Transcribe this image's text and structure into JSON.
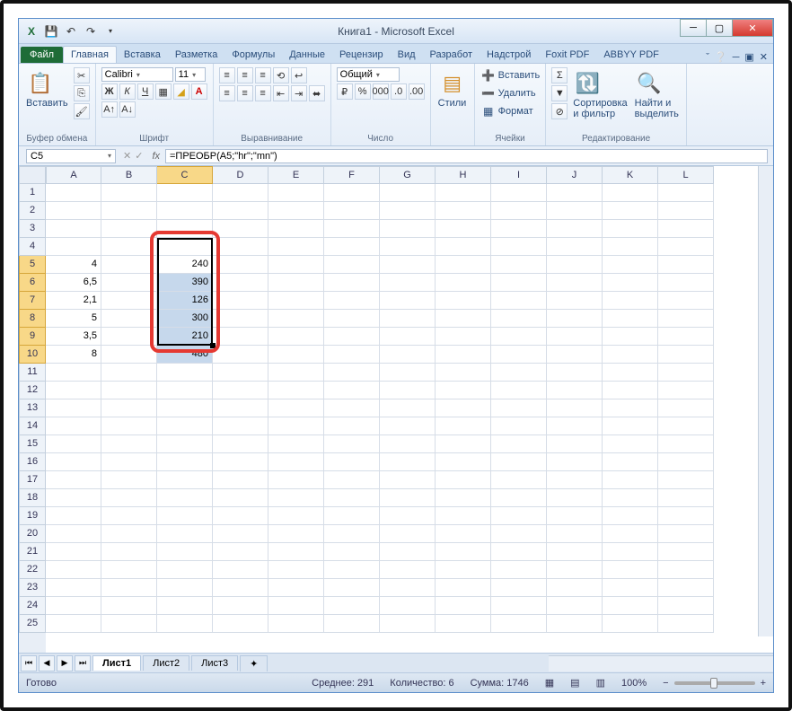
{
  "title": "Книга1  -  Microsoft Excel",
  "tabs": {
    "file": "Файл",
    "home": "Главная",
    "insert": "Вставка",
    "layout": "Разметка",
    "formulas": "Формулы",
    "data": "Данные",
    "review": "Рецензир",
    "view": "Вид",
    "dev": "Разработ",
    "addins": "Надстрой",
    "foxit": "Foxit PDF",
    "abbyy": "ABBYY PDF"
  },
  "groups": {
    "clipboard": {
      "label": "Буфер обмена",
      "paste": "Вставить"
    },
    "font": {
      "label": "Шрифт",
      "name": "Calibri",
      "size": "11"
    },
    "align": {
      "label": "Выравнивание"
    },
    "number": {
      "label": "Число",
      "format": "Общий"
    },
    "styles": {
      "label": "Стили",
      "btn": "Стили"
    },
    "cells": {
      "label": "Ячейки",
      "ins": "Вставить",
      "del": "Удалить",
      "fmt": "Формат"
    },
    "edit": {
      "label": "Редактирование",
      "sort": "Сортировка\nи фильтр",
      "find": "Найти и\nвыделить"
    }
  },
  "namebox": "C5",
  "formula": "=ПРЕОБР(A5;\"hr\";\"mn\")",
  "columns": [
    "A",
    "B",
    "C",
    "D",
    "E",
    "F",
    "G",
    "H",
    "I",
    "J",
    "K",
    "L"
  ],
  "rows": [
    "1",
    "2",
    "3",
    "4",
    "5",
    "6",
    "7",
    "8",
    "9",
    "10",
    "11",
    "12",
    "13",
    "14",
    "15",
    "16",
    "17",
    "18",
    "19",
    "20",
    "21",
    "22",
    "23",
    "24",
    "25"
  ],
  "dataA": {
    "5": "4",
    "6": "6,5",
    "7": "2,1",
    "8": "5",
    "9": "3,5",
    "10": "8"
  },
  "dataC": {
    "5": "240",
    "6": "390",
    "7": "126",
    "8": "300",
    "9": "210",
    "10": "480"
  },
  "sheets": {
    "s1": "Лист1",
    "s2": "Лист2",
    "s3": "Лист3"
  },
  "status": {
    "ready": "Готово",
    "avg": "Среднее: 291",
    "count": "Количество: 6",
    "sum": "Сумма: 1746",
    "zoom": "100%"
  }
}
